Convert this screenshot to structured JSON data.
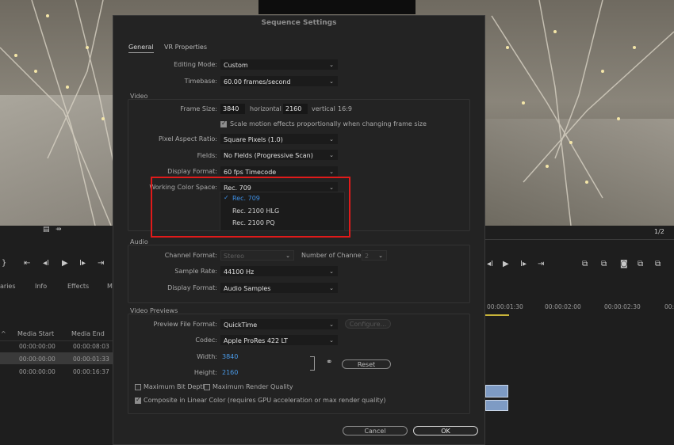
{
  "dialog": {
    "title": "Sequence Settings",
    "tabs": [
      {
        "label": "General"
      },
      {
        "label": "VR Properties"
      }
    ],
    "editing_mode": {
      "label": "Editing Mode:",
      "value": "Custom"
    },
    "timebase": {
      "label": "Timebase:",
      "value": "60.00  frames/second"
    },
    "video": {
      "section_label": "Video",
      "frame_size_label": "Frame Size:",
      "width": "3840",
      "horizontal_label": "horizontal",
      "height": "2160",
      "vertical_label": "vertical",
      "aspect": "16:9",
      "scale_checkbox_label": "Scale motion effects proportionally when changing frame size",
      "pixel_aspect": {
        "label": "Pixel Aspect Ratio:",
        "value": "Square Pixels (1.0)"
      },
      "fields": {
        "label": "Fields:",
        "value": "No Fields (Progressive Scan)"
      },
      "display_format": {
        "label": "Display Format:",
        "value": "60 fps Timecode"
      },
      "working_color_space": {
        "label": "Working Color Space:",
        "value": "Rec. 709",
        "options": [
          "Rec. 709",
          "Rec. 2100 HLG",
          "Rec. 2100 PQ"
        ],
        "checkmark": "✓"
      }
    },
    "audio": {
      "section_label": "Audio",
      "channel_format": {
        "label": "Channel Format:",
        "value": "Stereo"
      },
      "num_channels": {
        "label": "Number of Channels:",
        "value": "2"
      },
      "sample_rate": {
        "label": "Sample Rate:",
        "value": "44100 Hz"
      },
      "display_format": {
        "label": "Display Format:",
        "value": "Audio Samples"
      }
    },
    "video_previews": {
      "section_label": "Video Previews",
      "file_format": {
        "label": "Preview File Format:",
        "value": "QuickTime"
      },
      "configure_label": "Configure...",
      "codec": {
        "label": "Codec:",
        "value": "Apple ProRes 422 LT"
      },
      "width": {
        "label": "Width:",
        "value": "3840"
      },
      "height": {
        "label": "Height:",
        "value": "2160"
      },
      "reset_label": "Reset",
      "max_bit_depth": "Maximum Bit Depth",
      "max_render_quality": "Maximum Render Quality",
      "composite_linear": "Composite in Linear Color (requires GPU acceleration or max render quality)"
    },
    "cancel_label": "Cancel",
    "ok_label": "OK"
  },
  "left_panel": {
    "tabs": [
      "aries",
      "Info",
      "Effects",
      "M"
    ],
    "columns": [
      "Media Start",
      "Media End"
    ],
    "rows": [
      [
        "00:00:00:00",
        "00:00:08:03"
      ],
      [
        "00:00:00:00",
        "00:00:01:33"
      ],
      [
        "00:00:00:00",
        "00:00:16:37"
      ]
    ]
  },
  "right_panel": {
    "page_indicator": "1/2",
    "timecodes": [
      "00:00:01:30",
      "00:00:02:00",
      "00:00:02:30",
      "00:"
    ]
  },
  "colors": {
    "highlight": "#e01a1a",
    "selected_option": "#3d8fe5",
    "blue_value": "#4a9bea"
  }
}
